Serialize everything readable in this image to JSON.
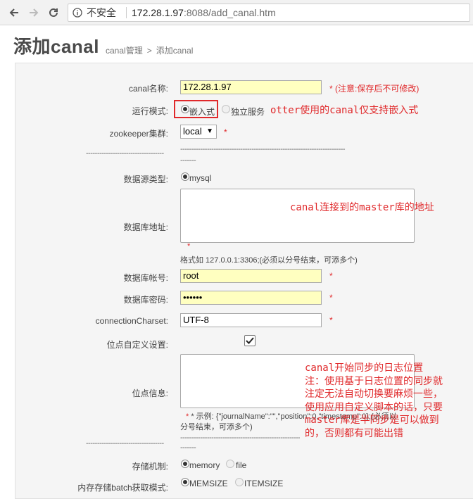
{
  "browser": {
    "security_label": "不安全",
    "url_host": "172.28.1.97",
    "url_path": ":8088/add_canal.htm"
  },
  "page": {
    "title": "添加canal",
    "breadcrumb": [
      "canal管理",
      ">",
      "添加canal"
    ]
  },
  "form": {
    "name": {
      "label": "canal名称:",
      "value": "172.28.1.97",
      "note": "* (注意:保存后不可修改)"
    },
    "mode": {
      "label": "运行模式:",
      "options": [
        "嵌入式",
        "独立服务"
      ],
      "selected": "嵌入式"
    },
    "zookeeper": {
      "label": "zookeeper集群:",
      "value": "local",
      "required": "*"
    },
    "divider1_left": "-----------------------------------",
    "divider1_right": "--------------------------------------------------------------------------",
    "divider1_wrap": "-------",
    "source_type": {
      "label": "数据源类型:",
      "option": "mysql"
    },
    "db_address": {
      "label": "数据库地址:",
      "required": "*",
      "hint": "格式如 127.0.0.1:3306;(必须以分号结束，可添多个)"
    },
    "db_account": {
      "label": "数据库帐号:",
      "value": "root",
      "required": "*"
    },
    "db_password": {
      "label": "数据库密码:",
      "value": "••••••",
      "required": "*"
    },
    "charset": {
      "label": "connectionCharset:",
      "value": "UTF-8",
      "required": "*"
    },
    "custom_position": {
      "label": "位点自定义设置:",
      "checked": true
    },
    "position_info": {
      "label": "位点信息:",
      "hint_line1": "* 示例: {\"journalName\":\"\",\"position\":0,\"timestamp\":0};(必须以",
      "hint_line2": "分号结束，可添多个)"
    },
    "divider2_left": "-----------------------------------",
    "divider2_right": "--------------------------------------------------------------------------",
    "divider2_wrap": "-------",
    "storage": {
      "label": "存储机制:",
      "options": [
        "memory",
        "file"
      ],
      "selected": "memory"
    },
    "batch_mode": {
      "label": "内存存储batch获取模式:",
      "options": [
        "MEMSIZE",
        "ITEMSIZE"
      ],
      "selected": "MEMSIZE"
    }
  },
  "annotations": {
    "mode_note": "otter使用的canal仅支持嵌入式",
    "address_note": "canal连接到的master库的地址",
    "position_note": [
      "canal开始同步的日志位置",
      "注：使用基于日志位置的同步就",
      "注定无法自动切换要麻烦一些，",
      "使用应用自定义脚本的话，只要",
      "master库是半同步是可以做到",
      "的，否则都有可能出错"
    ],
    "color": "#e0292b"
  }
}
